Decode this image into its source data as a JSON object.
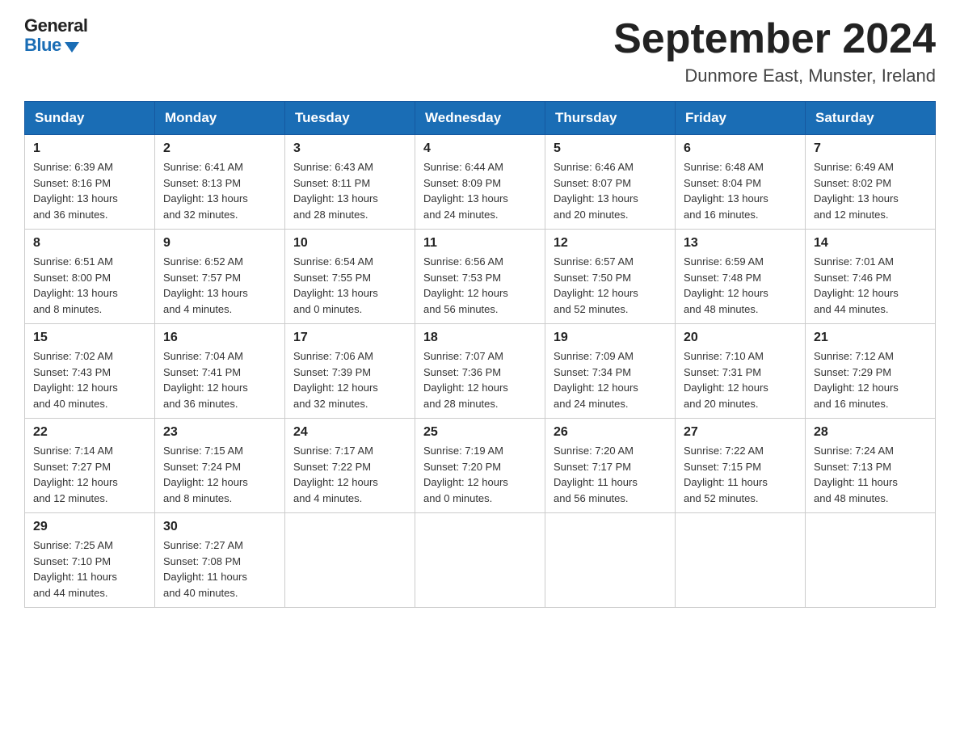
{
  "header": {
    "logo": {
      "general": "General",
      "blue": "Blue",
      "arrow": "▼"
    },
    "title": "September 2024",
    "subtitle": "Dunmore East, Munster, Ireland"
  },
  "days": [
    "Sunday",
    "Monday",
    "Tuesday",
    "Wednesday",
    "Thursday",
    "Friday",
    "Saturday"
  ],
  "weeks": [
    [
      {
        "num": "1",
        "sunrise": "6:39 AM",
        "sunset": "8:16 PM",
        "daylight": "13 hours and 36 minutes."
      },
      {
        "num": "2",
        "sunrise": "6:41 AM",
        "sunset": "8:13 PM",
        "daylight": "13 hours and 32 minutes."
      },
      {
        "num": "3",
        "sunrise": "6:43 AM",
        "sunset": "8:11 PM",
        "daylight": "13 hours and 28 minutes."
      },
      {
        "num": "4",
        "sunrise": "6:44 AM",
        "sunset": "8:09 PM",
        "daylight": "13 hours and 24 minutes."
      },
      {
        "num": "5",
        "sunrise": "6:46 AM",
        "sunset": "8:07 PM",
        "daylight": "13 hours and 20 minutes."
      },
      {
        "num": "6",
        "sunrise": "6:48 AM",
        "sunset": "8:04 PM",
        "daylight": "13 hours and 16 minutes."
      },
      {
        "num": "7",
        "sunrise": "6:49 AM",
        "sunset": "8:02 PM",
        "daylight": "13 hours and 12 minutes."
      }
    ],
    [
      {
        "num": "8",
        "sunrise": "6:51 AM",
        "sunset": "8:00 PM",
        "daylight": "13 hours and 8 minutes."
      },
      {
        "num": "9",
        "sunrise": "6:52 AM",
        "sunset": "7:57 PM",
        "daylight": "13 hours and 4 minutes."
      },
      {
        "num": "10",
        "sunrise": "6:54 AM",
        "sunset": "7:55 PM",
        "daylight": "13 hours and 0 minutes."
      },
      {
        "num": "11",
        "sunrise": "6:56 AM",
        "sunset": "7:53 PM",
        "daylight": "12 hours and 56 minutes."
      },
      {
        "num": "12",
        "sunrise": "6:57 AM",
        "sunset": "7:50 PM",
        "daylight": "12 hours and 52 minutes."
      },
      {
        "num": "13",
        "sunrise": "6:59 AM",
        "sunset": "7:48 PM",
        "daylight": "12 hours and 48 minutes."
      },
      {
        "num": "14",
        "sunrise": "7:01 AM",
        "sunset": "7:46 PM",
        "daylight": "12 hours and 44 minutes."
      }
    ],
    [
      {
        "num": "15",
        "sunrise": "7:02 AM",
        "sunset": "7:43 PM",
        "daylight": "12 hours and 40 minutes."
      },
      {
        "num": "16",
        "sunrise": "7:04 AM",
        "sunset": "7:41 PM",
        "daylight": "12 hours and 36 minutes."
      },
      {
        "num": "17",
        "sunrise": "7:06 AM",
        "sunset": "7:39 PM",
        "daylight": "12 hours and 32 minutes."
      },
      {
        "num": "18",
        "sunrise": "7:07 AM",
        "sunset": "7:36 PM",
        "daylight": "12 hours and 28 minutes."
      },
      {
        "num": "19",
        "sunrise": "7:09 AM",
        "sunset": "7:34 PM",
        "daylight": "12 hours and 24 minutes."
      },
      {
        "num": "20",
        "sunrise": "7:10 AM",
        "sunset": "7:31 PM",
        "daylight": "12 hours and 20 minutes."
      },
      {
        "num": "21",
        "sunrise": "7:12 AM",
        "sunset": "7:29 PM",
        "daylight": "12 hours and 16 minutes."
      }
    ],
    [
      {
        "num": "22",
        "sunrise": "7:14 AM",
        "sunset": "7:27 PM",
        "daylight": "12 hours and 12 minutes."
      },
      {
        "num": "23",
        "sunrise": "7:15 AM",
        "sunset": "7:24 PM",
        "daylight": "12 hours and 8 minutes."
      },
      {
        "num": "24",
        "sunrise": "7:17 AM",
        "sunset": "7:22 PM",
        "daylight": "12 hours and 4 minutes."
      },
      {
        "num": "25",
        "sunrise": "7:19 AM",
        "sunset": "7:20 PM",
        "daylight": "12 hours and 0 minutes."
      },
      {
        "num": "26",
        "sunrise": "7:20 AM",
        "sunset": "7:17 PM",
        "daylight": "11 hours and 56 minutes."
      },
      {
        "num": "27",
        "sunrise": "7:22 AM",
        "sunset": "7:15 PM",
        "daylight": "11 hours and 52 minutes."
      },
      {
        "num": "28",
        "sunrise": "7:24 AM",
        "sunset": "7:13 PM",
        "daylight": "11 hours and 48 minutes."
      }
    ],
    [
      {
        "num": "29",
        "sunrise": "7:25 AM",
        "sunset": "7:10 PM",
        "daylight": "11 hours and 44 minutes."
      },
      {
        "num": "30",
        "sunrise": "7:27 AM",
        "sunset": "7:08 PM",
        "daylight": "11 hours and 40 minutes."
      },
      null,
      null,
      null,
      null,
      null
    ]
  ],
  "labels": {
    "sunrise": "Sunrise:",
    "sunset": "Sunset:",
    "daylight": "Daylight:"
  }
}
